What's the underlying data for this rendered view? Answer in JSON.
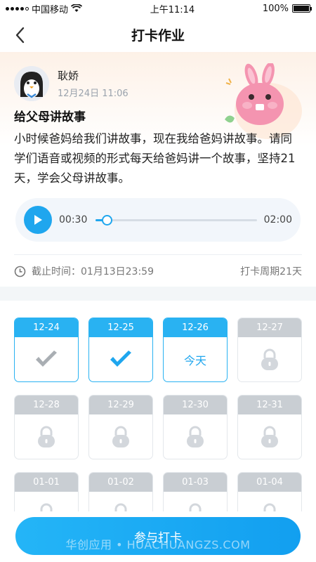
{
  "status_bar": {
    "carrier": "中国移动",
    "time": "上午11:14",
    "battery": "100%"
  },
  "nav": {
    "title": "打卡作业"
  },
  "post": {
    "author": "耿娇",
    "date": "12月24日 11:06",
    "title": "给父母讲故事",
    "description": "小时候爸妈给我们讲故事，现在我给爸妈讲故事。请同学们语音或视频的形式每天给爸妈讲一个故事，坚持21天，学会父母讲故事。"
  },
  "audio": {
    "current_time": "00:30",
    "total_time": "02:00",
    "progress_fraction": 0.07
  },
  "deadline": {
    "label": "截止时间：01月13日23:59",
    "cycle": "打卡周期21天"
  },
  "days": [
    {
      "date": "12-24",
      "state": "done"
    },
    {
      "date": "12-25",
      "state": "done"
    },
    {
      "date": "12-26",
      "state": "today",
      "text": "今天"
    },
    {
      "date": "12-27",
      "state": "locked"
    },
    {
      "date": "12-28",
      "state": "locked"
    },
    {
      "date": "12-29",
      "state": "locked"
    },
    {
      "date": "12-30",
      "state": "locked"
    },
    {
      "date": "12-31",
      "state": "locked"
    },
    {
      "date": "01-01",
      "state": "locked"
    },
    {
      "date": "01-02",
      "state": "locked"
    },
    {
      "date": "01-03",
      "state": "locked"
    },
    {
      "date": "01-04",
      "state": "locked"
    }
  ],
  "cta": {
    "label": "参与打卡"
  },
  "watermark": "华创应用 • HUACHUANGZS.COM",
  "colors": {
    "accent": "#1fa6ee",
    "locked": "#c9ced3",
    "check_done_gray": "#a9aeb3"
  }
}
